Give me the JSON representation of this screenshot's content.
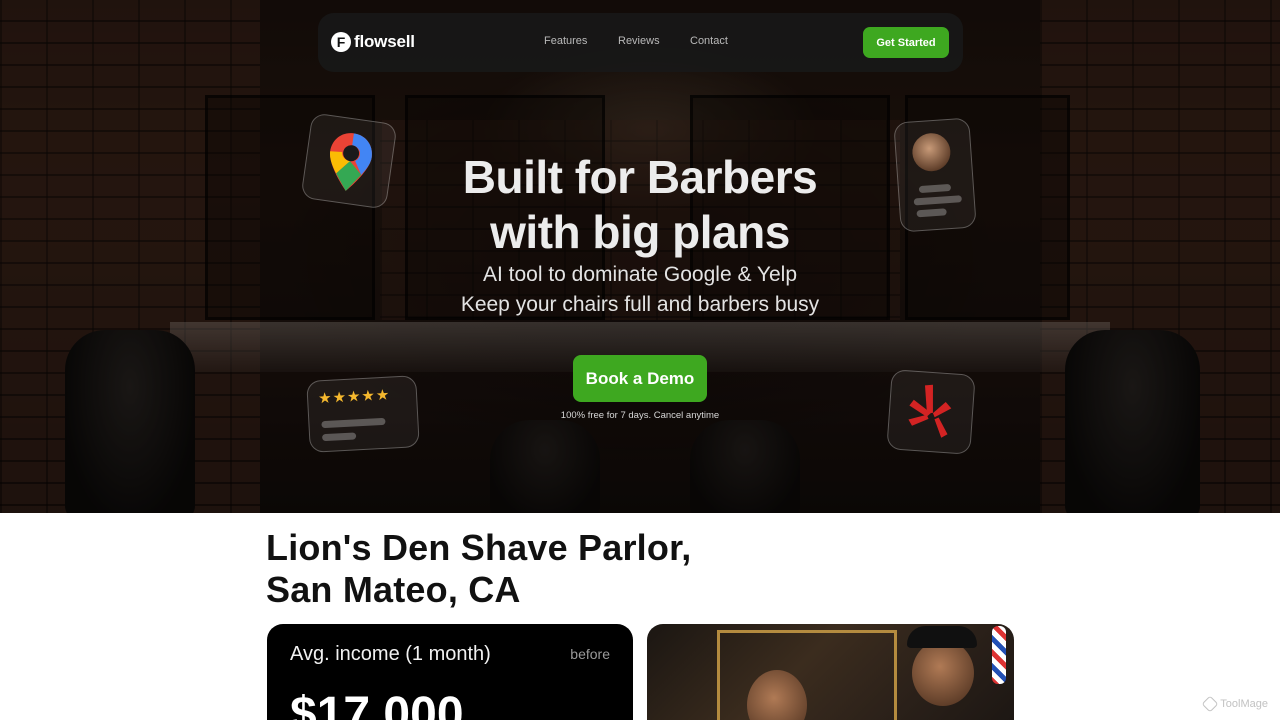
{
  "nav": {
    "logo_mark": "F",
    "brand": "flowsell",
    "links": [
      "Features",
      "Reviews",
      "Contact"
    ],
    "cta": "Get Started"
  },
  "hero": {
    "headline_line1": "Built for Barbers",
    "headline_line2": "with big plans",
    "sub_line1": "AI tool to dominate Google & Yelp",
    "sub_line2": "Keep your chairs full and barbers busy",
    "cta": "Book a Demo",
    "note": "100% free for 7 days. Cancel anytime",
    "rating_stars": 5
  },
  "case_study": {
    "shop_line1": "Lion's Den Shave Parlor,",
    "shop_line2": "San Mateo, CA",
    "income_label": "Avg. income (1 month)",
    "income_tag": "before",
    "income_value": "$17,000"
  },
  "watermark": "ToolMage",
  "colors": {
    "accent_green": "#3ea820",
    "navbar_bg": "#181818",
    "card_bg": "#000000",
    "yelp_red": "#d32323"
  },
  "icons": [
    "google-maps-icon",
    "yelp-icon",
    "star-icon",
    "avatar"
  ]
}
